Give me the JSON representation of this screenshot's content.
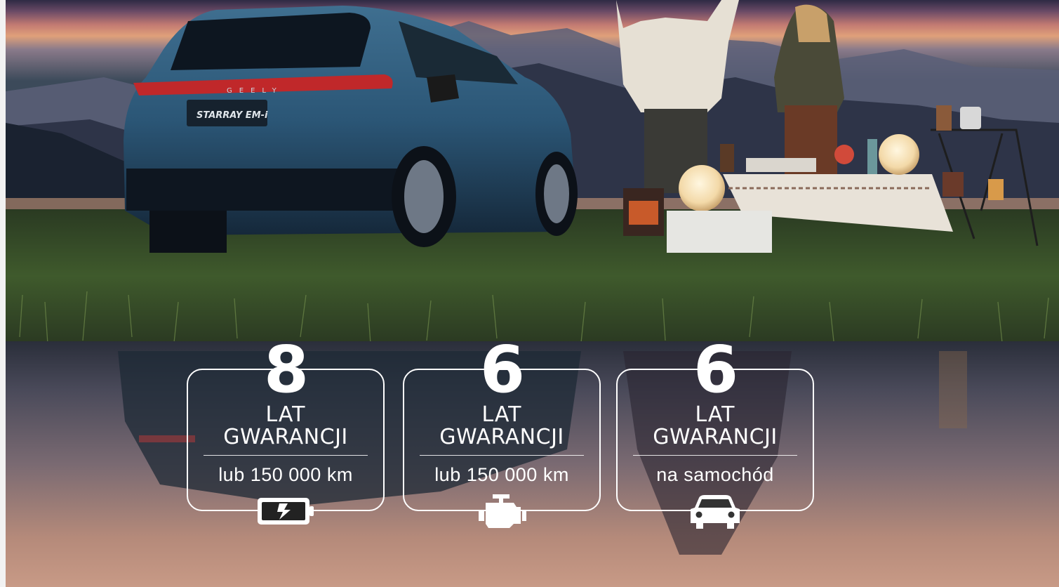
{
  "hero": {
    "brand_rear_text": "GEELY",
    "model_badge": "STARRAY EM-i"
  },
  "warranties": [
    {
      "number": "8",
      "line1": "LAT",
      "line2": "GWARANCJI",
      "detail": "lub 150 000 km",
      "icon": "battery-charge-icon"
    },
    {
      "number": "6",
      "line1": "LAT",
      "line2": "GWARANCJI",
      "detail": "lub 150 000 km",
      "icon": "engine-icon"
    },
    {
      "number": "6",
      "line1": "LAT",
      "line2": "GWARANCJI",
      "detail": "na samochód",
      "icon": "car-icon"
    }
  ],
  "colors": {
    "badge_outline": "#ffffff",
    "sky_top": "#3a3550",
    "sky_glow": "#d98a6a",
    "grass": "#3d5a2a",
    "car_body": "#2f5a7a"
  }
}
